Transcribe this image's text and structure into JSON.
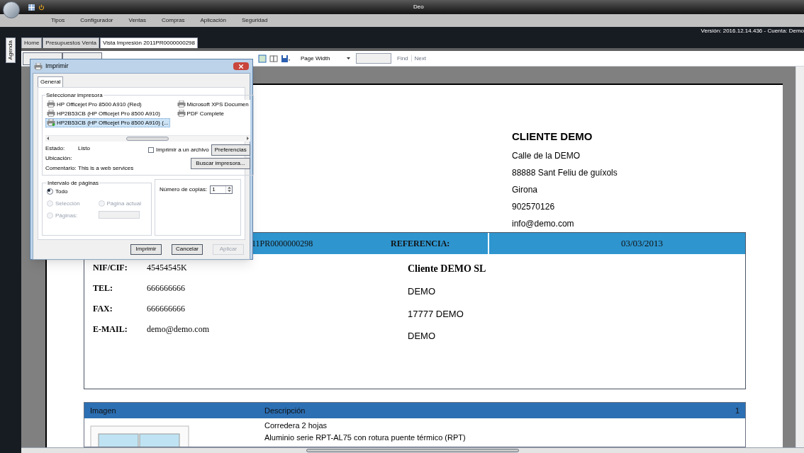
{
  "window": {
    "title": "Deo"
  },
  "menu": [
    "Tipos",
    "Configurador",
    "Ventas",
    "Compras",
    "Aplicación",
    "Seguridad"
  ],
  "version_label": "Versión: 2016.12.14.436 - Cuenta: Demo",
  "side_tab": "Agenda",
  "tabs": [
    {
      "label": "Home",
      "selected": false
    },
    {
      "label": "Presupuestos Venta",
      "selected": false
    },
    {
      "label": "Vista Impresión 2011PR0000000298",
      "selected": true
    }
  ],
  "toolbar": {
    "zoom_mode": "Page Width",
    "find": "Find",
    "next": "Next"
  },
  "document": {
    "company": {
      "name": "CLIENTE DEMO",
      "lines": [
        "Calle de la DEMO",
        "88888 Sant Feliu de guíxols",
        "Girona",
        "902570126",
        "info@demo.com"
      ]
    },
    "header_bar": {
      "number": "11PR0000000298",
      "reference_label": "REFERENCIA:",
      "date": "03/03/2013"
    },
    "contact": [
      {
        "label": "NIF/CIF:",
        "value": "45454545K"
      },
      {
        "label": "TEL:",
        "value": "666666666"
      },
      {
        "label": "FAX:",
        "value": "666666666"
      },
      {
        "label": "E-MAIL:",
        "value": "demo@demo.com"
      }
    ],
    "client": {
      "name": "Cliente DEMO SL",
      "lines": [
        "DEMO",
        "17777 DEMO",
        "DEMO"
      ]
    },
    "items_table": {
      "columns": [
        "Imagen",
        "Descripción",
        "1"
      ],
      "rows": [
        {
          "description": [
            "Corredera 2 hojas",
            "Aluminio serie RPT-AL75 con rotura puente térmico (RPT)"
          ]
        }
      ]
    }
  },
  "print_dialog": {
    "title": "Imprimir",
    "tab": "General",
    "printer_group": "Seleccionar impresora",
    "printers": [
      {
        "name": "HP Officejet Pro 8500 A910 (Red)",
        "selected": false
      },
      {
        "name": "HP2B53CB (HP Officejet Pro 8500 A910)",
        "selected": false
      },
      {
        "name": "HP2B53CB (HP Officejet Pro 8500 A910) (...",
        "selected": true
      },
      {
        "name": "Microsoft XPS Documen",
        "selected": false
      },
      {
        "name": "PDF Complete",
        "selected": false
      }
    ],
    "info": [
      {
        "label": "Estado:",
        "value": "Listo"
      },
      {
        "label": "Ubicación:"
      },
      {
        "label": "Comentario:",
        "value": "This is a web services"
      }
    ],
    "print_to_file": {
      "label": "Imprimir a un archivo",
      "checked": false
    },
    "preferences_button": "Preferencias",
    "find_printer_button": "Buscar impresora...",
    "range_group": "Intervalo de páginas",
    "range_options": [
      {
        "label": "Todo",
        "selected": true,
        "disabled": false
      },
      {
        "label": "Selección",
        "selected": false,
        "disabled": true
      },
      {
        "label": "Página actual",
        "selected": false,
        "disabled": true
      },
      {
        "label": "Páginas:",
        "selected": false,
        "disabled": true
      }
    ],
    "copies_label": "Número de copias:",
    "copies": "1",
    "buttons": [
      {
        "label": "Imprimir",
        "disabled": false
      },
      {
        "label": "Cancelar",
        "disabled": false
      },
      {
        "label": "Aplicar",
        "disabled": true
      }
    ]
  }
}
